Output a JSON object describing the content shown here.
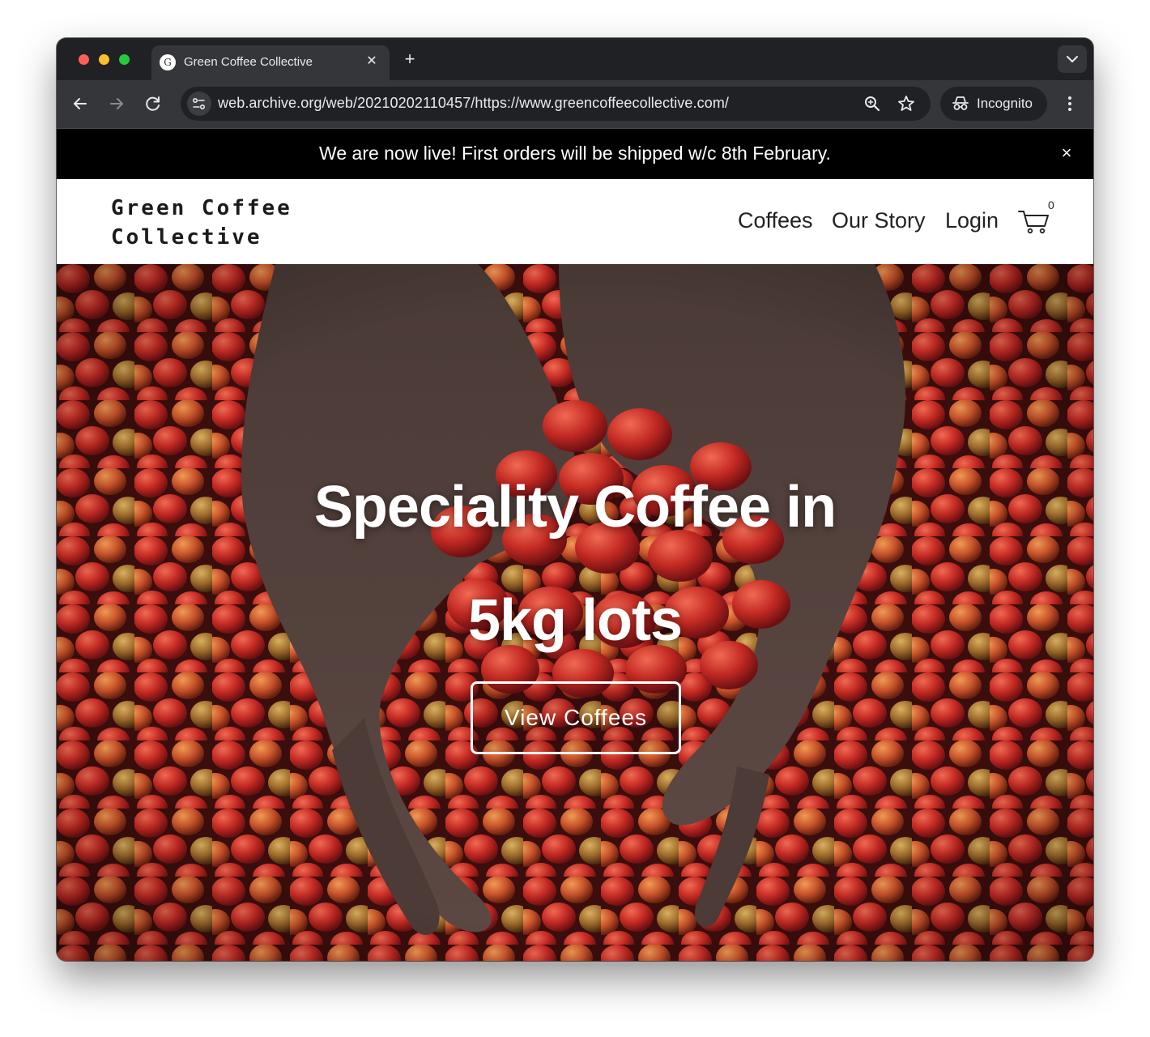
{
  "browser": {
    "tab_title": "Green Coffee Collective",
    "tab_favicon": "G",
    "new_tab_symbol": "+",
    "tab_close_symbol": "✕",
    "url": "web.archive.org/web/20210202110457/https://www.greencoffeecollective.com/",
    "profile_label": "Incognito",
    "icons": [
      "back-icon",
      "forward-icon",
      "reload-icon",
      "site-info-icon",
      "zoom-icon",
      "bookmark-star-icon",
      "incognito-icon",
      "menu-icon",
      "tab-search-icon"
    ]
  },
  "announcement": {
    "text": "We are now live! First orders will be shipped w/c 8th February.",
    "close_symbol": "×"
  },
  "header": {
    "logo_line1": "Green Coffee",
    "logo_line2": "Collective",
    "nav": [
      "Coffees",
      "Our Story",
      "Login"
    ],
    "cart_count": "0"
  },
  "hero": {
    "title_line1": "Speciality Coffee in",
    "title_line2": "5kg lots",
    "button_label": "View Coffees"
  },
  "colors": {
    "chrome_dark": "#202124",
    "chrome_toolbar": "#35363a",
    "announcement_bg": "#000000",
    "hero_text": "#ffffff"
  }
}
